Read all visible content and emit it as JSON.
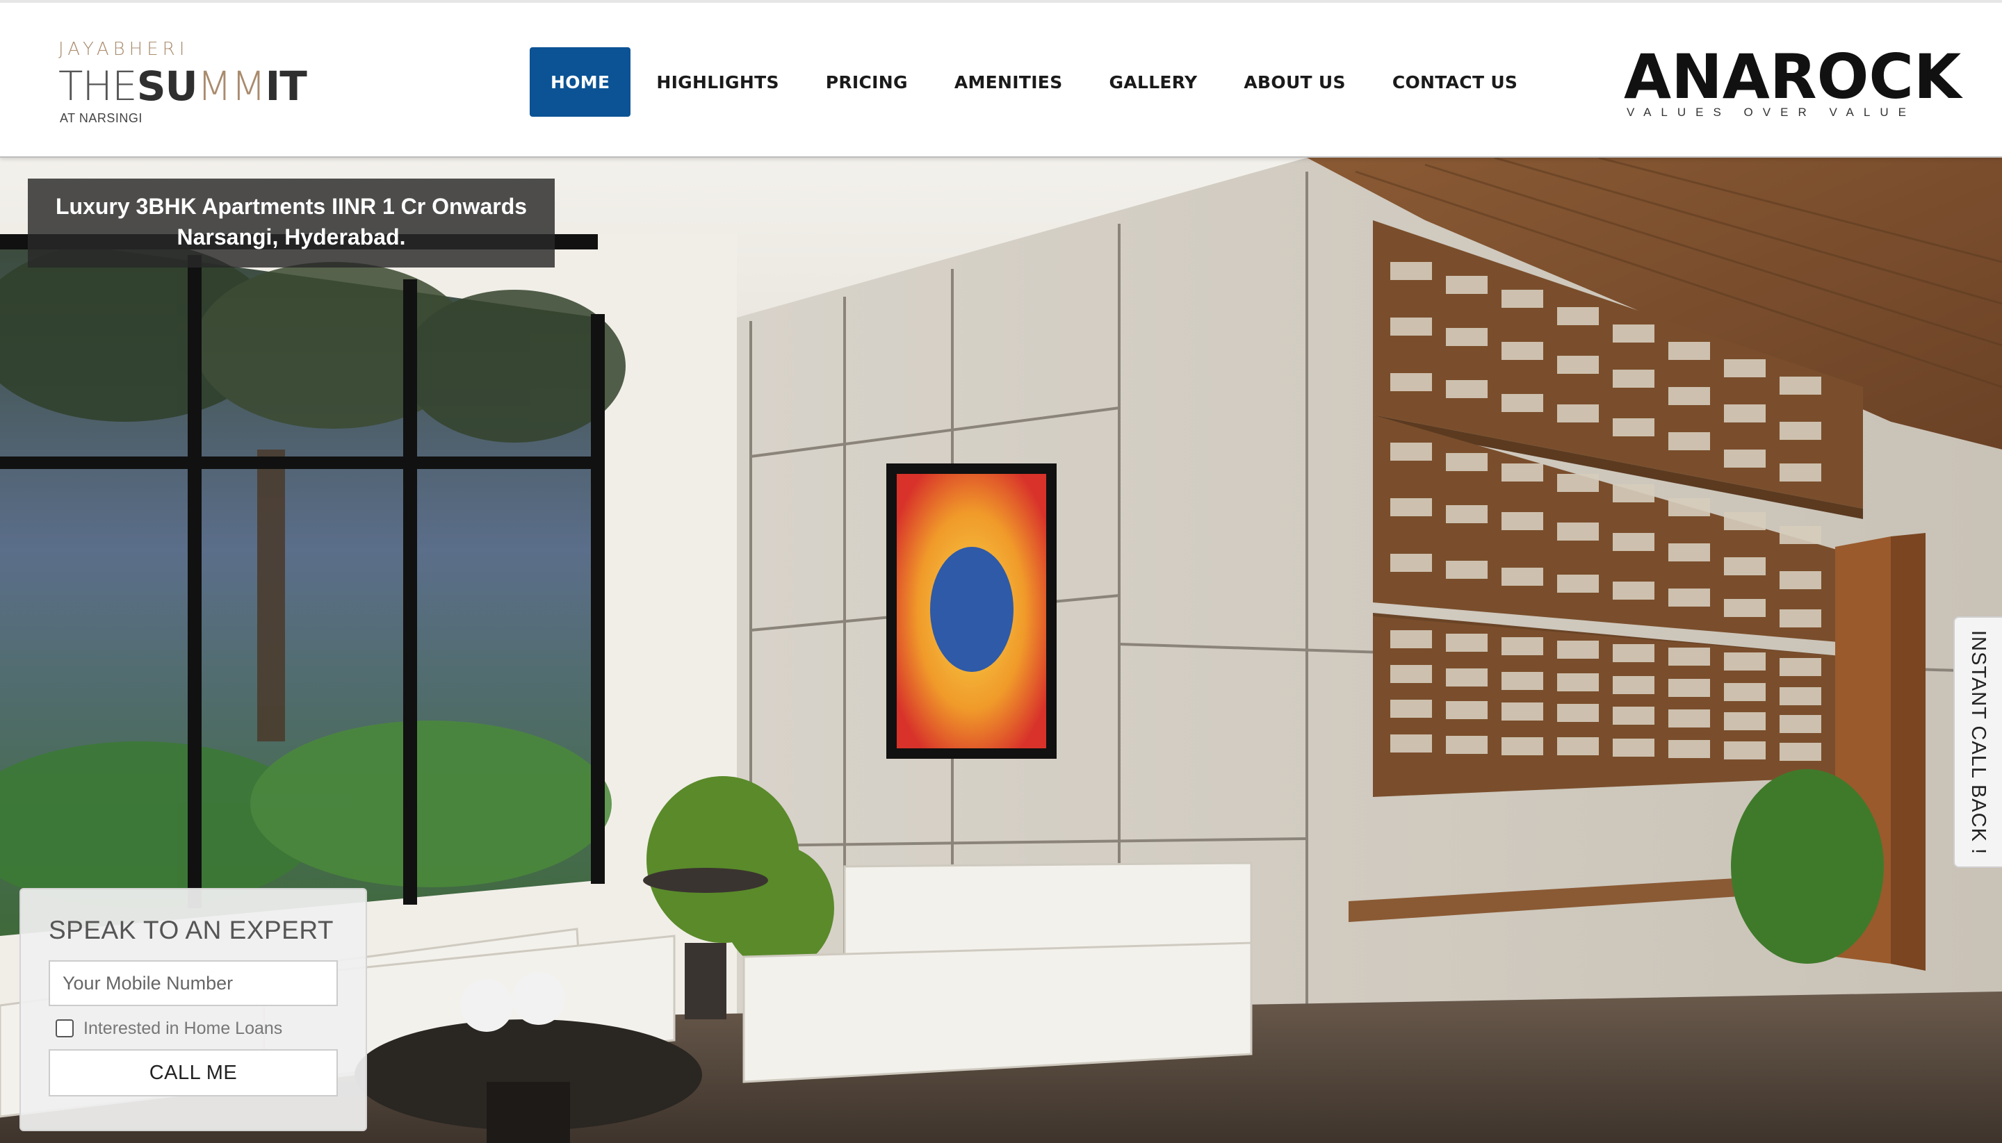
{
  "brand": {
    "top": "JAYABHERI",
    "main_a": "THE",
    "main_b": "SU",
    "main_c": "MM",
    "main_d": "IT",
    "sub": "AT NARSINGI"
  },
  "nav": {
    "items": [
      {
        "label": "HOME",
        "active": true
      },
      {
        "label": "HIGHLIGHTS"
      },
      {
        "label": "PRICING"
      },
      {
        "label": "AMENITIES"
      },
      {
        "label": "GALLERY"
      },
      {
        "label": "ABOUT US"
      },
      {
        "label": "CONTACT US"
      }
    ]
  },
  "partner": {
    "name": "ANAROCK",
    "tagline": "VALUES OVER VALUE"
  },
  "hero": {
    "caption_line1": "Luxury 3BHK Apartments IINR 1 Cr Onwards",
    "caption_line2": "Narsangi, Hyderabad."
  },
  "callback": {
    "label": "INSTANT CALL BACK !"
  },
  "expert": {
    "title": "SPEAK TO AN EXPERT",
    "mobile_placeholder": "Your Mobile Number",
    "loan_label": "Interested in Home Loans",
    "button": "CALL ME"
  },
  "colors": {
    "nav_active": "#0b5394",
    "brand_accent": "#a98b6d"
  }
}
